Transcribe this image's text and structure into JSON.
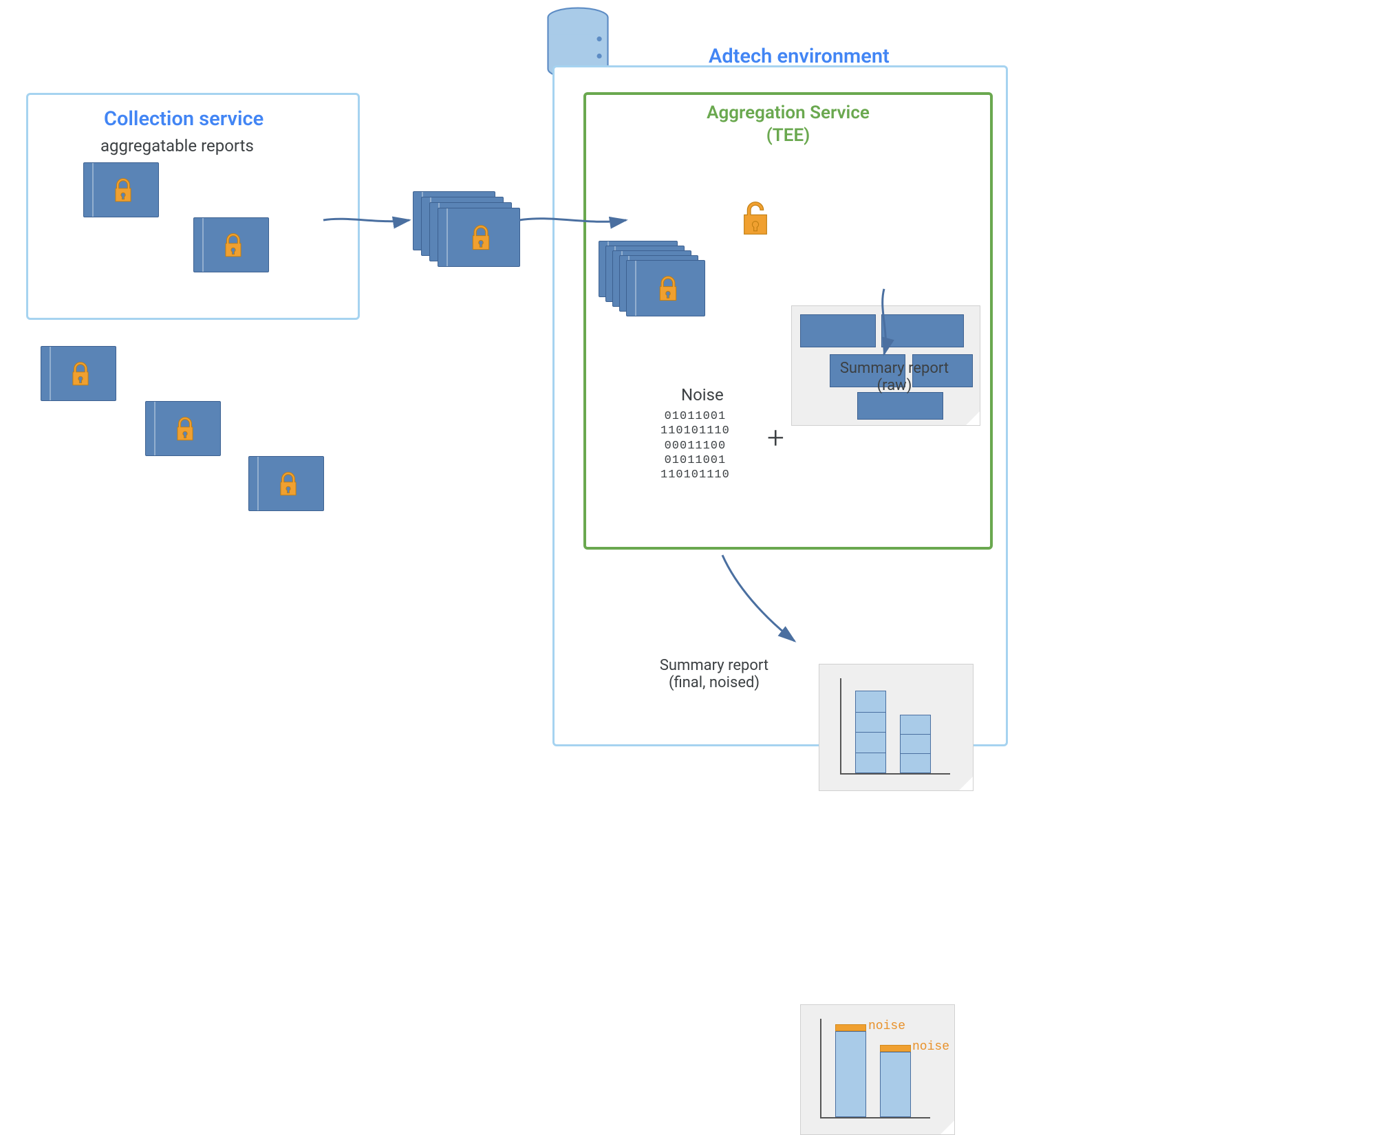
{
  "collection_service": {
    "title": "Collection service",
    "subtitle": "aggregatable reports"
  },
  "adtech": {
    "title": "Adtech environment"
  },
  "aggregation_service": {
    "title_line1": "Aggregation Service",
    "title_line2": "(TEE)"
  },
  "noise": {
    "label": "Noise",
    "bits": "01011001\n110101110\n00011100\n01011001\n110101110"
  },
  "plus": "+",
  "summary_raw": {
    "label_line1": "Summary report",
    "label_line2": "(raw)"
  },
  "summary_final": {
    "label_line1": "Summary report",
    "label_line2": "(final, noised)",
    "noise_tag": "noise"
  },
  "icons": {
    "locked": "lock",
    "unlocked": "unlock",
    "database": "database"
  },
  "colors": {
    "blue_frame": "#a6d3f0",
    "green_frame": "#6aa84f",
    "blue_fill": "#5a84b6",
    "orange": "#f0a030",
    "title_blue": "#4285f4"
  }
}
